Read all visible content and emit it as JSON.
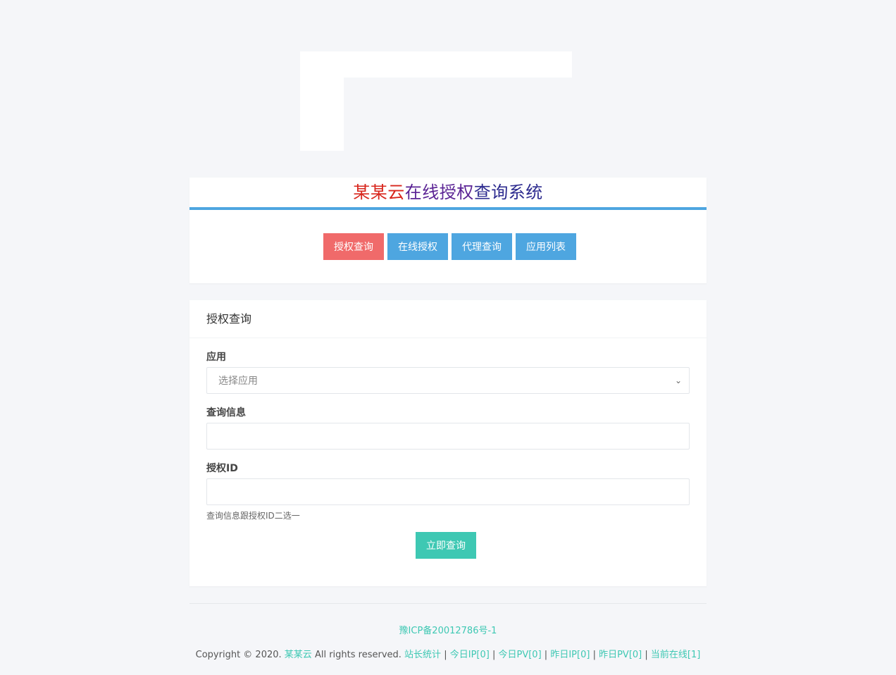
{
  "header": {
    "title_part1": "某某云",
    "title_part2": "在线授权",
    "title_part3": "查询系统"
  },
  "nav": [
    {
      "label": "授权查询",
      "active": true
    },
    {
      "label": "在线授权",
      "active": false
    },
    {
      "label": "代理查询",
      "active": false
    },
    {
      "label": "应用列表",
      "active": false
    }
  ],
  "form": {
    "card_title": "授权查询",
    "app_label": "应用",
    "app_select_value": "选择应用",
    "query_label": "查询信息",
    "query_value": "",
    "auth_id_label": "授权ID",
    "auth_id_value": "",
    "hint": "查询信息跟授权ID二选一",
    "submit_label": "立即查询"
  },
  "footer": {
    "icp": "豫ICP备20012786号-1",
    "copyright_prefix": "Copyright © 2020.",
    "brand": "某某云",
    "rights": "All rights reserved.",
    "stats_label": "站长统计",
    "today_ip": "今日IP[0]",
    "today_pv": "今日PV[0]",
    "yesterday_ip": "昨日IP[0]",
    "yesterday_pv": "昨日PV[0]",
    "online": "当前在线[1]"
  },
  "colors": {
    "accent_blue": "#4ea6e0",
    "accent_red": "#f06a6a",
    "accent_teal": "#3ec8b3"
  }
}
